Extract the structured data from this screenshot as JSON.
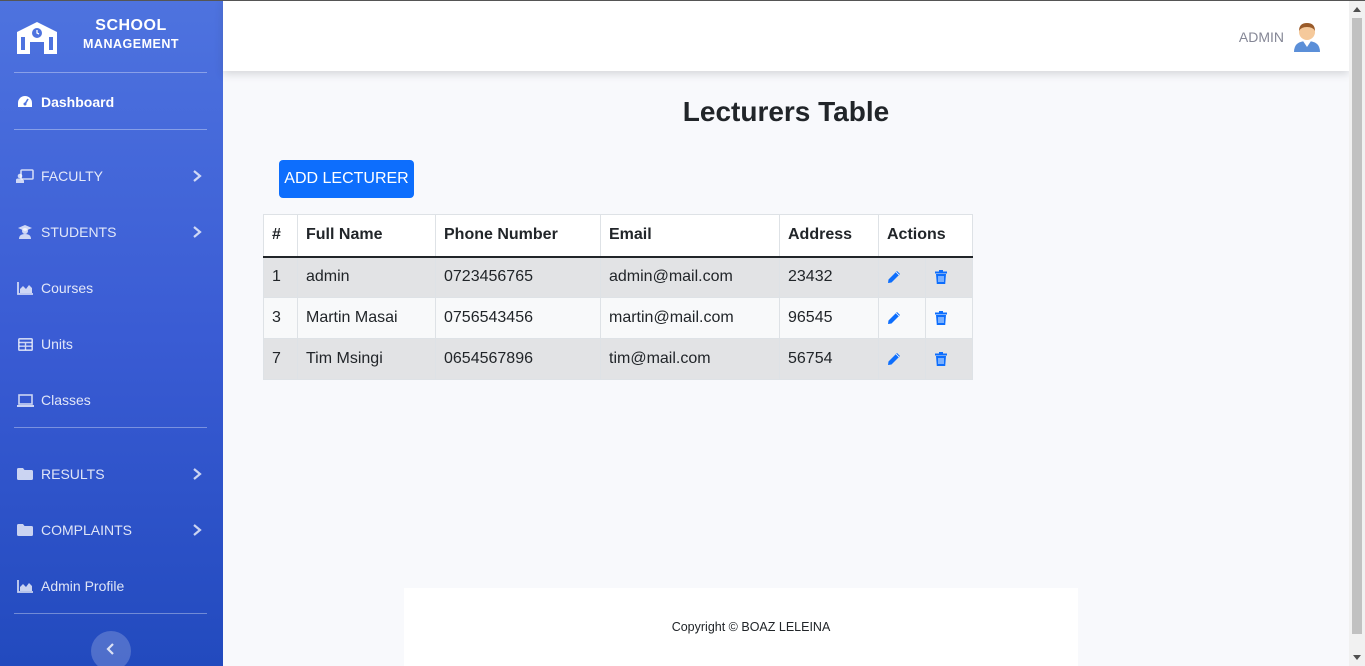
{
  "brand": {
    "line1": "SCHOOL",
    "line2": "MANAGEMENT"
  },
  "sidebar": {
    "items": [
      {
        "label": "Dashboard",
        "icon": "tachometer-icon"
      },
      {
        "label": "FACULTY",
        "icon": "chalkboard-teacher-icon",
        "has_submenu": true
      },
      {
        "label": "STUDENTS",
        "icon": "user-graduate-icon",
        "has_submenu": true
      },
      {
        "label": "Courses",
        "icon": "chart-area-icon"
      },
      {
        "label": "Units",
        "icon": "table-icon"
      },
      {
        "label": "Classes",
        "icon": "laptop-icon"
      },
      {
        "label": "RESULTS",
        "icon": "folder-icon",
        "has_submenu": true
      },
      {
        "label": "COMPLAINTS",
        "icon": "folder-icon",
        "has_submenu": true
      },
      {
        "label": "Admin Profile",
        "icon": "chart-area-icon"
      }
    ]
  },
  "topbar": {
    "user_name": "ADMIN"
  },
  "main": {
    "title": "Lecturers Table",
    "add_button": "ADD LECTURER",
    "table": {
      "headers": [
        "#",
        "Full Name",
        "Phone Number",
        "Email",
        "Address",
        "Actions"
      ],
      "rows": [
        {
          "id": "1",
          "name": "admin",
          "phone": "0723456765",
          "email": "admin@mail.com",
          "address": "23432"
        },
        {
          "id": "3",
          "name": "Martin Masai",
          "phone": "0756543456",
          "email": "martin@mail.com",
          "address": "96545"
        },
        {
          "id": "7",
          "name": "Tim Msingi",
          "phone": "0654567896",
          "email": "tim@mail.com",
          "address": "56754"
        }
      ]
    }
  },
  "footer": {
    "copyright": "Copyright © BOAZ LELEINA"
  },
  "colors": {
    "sidebar_top": "#4e73df",
    "sidebar_bottom": "#224abe",
    "primary_button": "#0d6efd",
    "action_icon": "#0d6efd"
  }
}
